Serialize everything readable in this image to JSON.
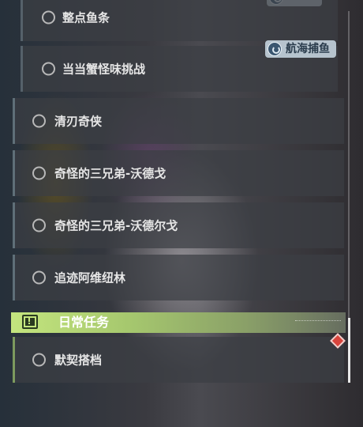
{
  "quests": {
    "top_sub": {
      "label": "整点鱼条"
    },
    "second_sub": {
      "label": "当当蟹怪味挑战",
      "tag": "航海捕鱼"
    },
    "items": [
      {
        "label": "清刃奇侠"
      },
      {
        "label": "奇怪的三兄弟-沃德戈"
      },
      {
        "label": "奇怪的三兄弟-沃德尔戈"
      },
      {
        "label": "追迹阿维纽林"
      }
    ]
  },
  "daily": {
    "title": "日常任务",
    "items": [
      {
        "label": "默契搭档"
      }
    ]
  },
  "colors": {
    "daily_accent": "#c4e57e",
    "alert_diamond": "#d8443c"
  }
}
